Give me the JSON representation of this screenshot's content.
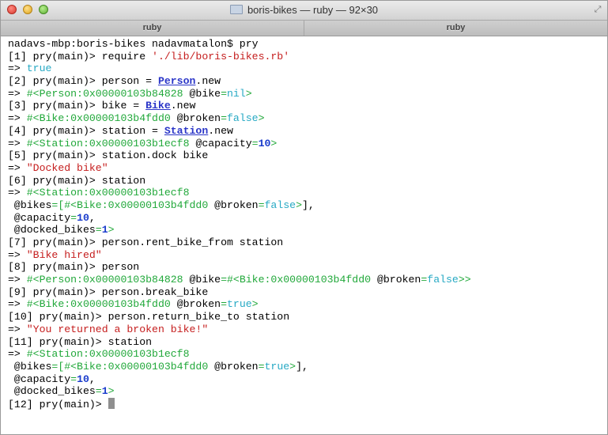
{
  "window": {
    "title": "boris-bikes — ruby — 92×30",
    "tabs": [
      "ruby",
      "ruby"
    ]
  },
  "terminal": {
    "lines": [
      {
        "segments": [
          {
            "text": "nadavs-mbp:boris-bikes nadavmatalon$ pry",
            "style": "plain"
          }
        ]
      },
      {
        "segments": [
          {
            "text": "[1] pry(main)> require ",
            "style": "plain"
          },
          {
            "text": "'./lib/boris-bikes.rb'",
            "style": "str"
          }
        ]
      },
      {
        "segments": [
          {
            "text": "=> ",
            "style": "plain"
          },
          {
            "text": "true",
            "style": "kw"
          }
        ]
      },
      {
        "segments": [
          {
            "text": "[2] pry(main)> person = ",
            "style": "plain"
          },
          {
            "text": "Person",
            "style": "cls"
          },
          {
            "text": ".new",
            "style": "plain"
          }
        ]
      },
      {
        "segments": [
          {
            "text": "=> ",
            "style": "plain"
          },
          {
            "text": "#<Person:0x00000103b84828 ",
            "style": "rv"
          },
          {
            "text": "@bike",
            "style": "plain"
          },
          {
            "text": "=",
            "style": "rv"
          },
          {
            "text": "nil",
            "style": "kw"
          },
          {
            "text": ">",
            "style": "rv"
          }
        ]
      },
      {
        "segments": [
          {
            "text": "[3] pry(main)> bike = ",
            "style": "plain"
          },
          {
            "text": "Bike",
            "style": "cls"
          },
          {
            "text": ".new",
            "style": "plain"
          }
        ]
      },
      {
        "segments": [
          {
            "text": "=> ",
            "style": "plain"
          },
          {
            "text": "#<Bike:0x00000103b4fdd0 ",
            "style": "rv"
          },
          {
            "text": "@broken",
            "style": "plain"
          },
          {
            "text": "=",
            "style": "rv"
          },
          {
            "text": "false",
            "style": "kw"
          },
          {
            "text": ">",
            "style": "rv"
          }
        ]
      },
      {
        "segments": [
          {
            "text": "[4] pry(main)> station = ",
            "style": "plain"
          },
          {
            "text": "Station",
            "style": "cls"
          },
          {
            "text": ".new",
            "style": "plain"
          }
        ]
      },
      {
        "segments": [
          {
            "text": "=> ",
            "style": "plain"
          },
          {
            "text": "#<Station:0x00000103b1ecf8 ",
            "style": "rv"
          },
          {
            "text": "@capacity",
            "style": "plain"
          },
          {
            "text": "=",
            "style": "rv"
          },
          {
            "text": "10",
            "style": "num"
          },
          {
            "text": ">",
            "style": "rv"
          }
        ]
      },
      {
        "segments": [
          {
            "text": "[5] pry(main)> station.dock bike",
            "style": "plain"
          }
        ]
      },
      {
        "segments": [
          {
            "text": "=> ",
            "style": "plain"
          },
          {
            "text": "\"Docked bike\"",
            "style": "str"
          }
        ]
      },
      {
        "segments": [
          {
            "text": "[6] pry(main)> station",
            "style": "plain"
          }
        ]
      },
      {
        "segments": [
          {
            "text": "=> ",
            "style": "plain"
          },
          {
            "text": "#<Station:0x00000103b1ecf8",
            "style": "rv"
          }
        ]
      },
      {
        "segments": [
          {
            "text": " @bikes",
            "style": "plain"
          },
          {
            "text": "=[",
            "style": "rv"
          },
          {
            "text": "#<Bike:0x00000103b4fdd0 ",
            "style": "rv"
          },
          {
            "text": "@broken",
            "style": "plain"
          },
          {
            "text": "=",
            "style": "rv"
          },
          {
            "text": "false",
            "style": "kw"
          },
          {
            "text": ">",
            "style": "rv"
          },
          {
            "text": "],",
            "style": "plain"
          }
        ]
      },
      {
        "segments": [
          {
            "text": " @capacity",
            "style": "plain"
          },
          {
            "text": "=",
            "style": "rv"
          },
          {
            "text": "10",
            "style": "num"
          },
          {
            "text": ",",
            "style": "plain"
          }
        ]
      },
      {
        "segments": [
          {
            "text": " @docked_bikes",
            "style": "plain"
          },
          {
            "text": "=",
            "style": "rv"
          },
          {
            "text": "1",
            "style": "num"
          },
          {
            "text": ">",
            "style": "rv"
          }
        ]
      },
      {
        "segments": [
          {
            "text": "[7] pry(main)> person.rent_bike_from station",
            "style": "plain"
          }
        ]
      },
      {
        "segments": [
          {
            "text": "=> ",
            "style": "plain"
          },
          {
            "text": "\"Bike hired\"",
            "style": "str"
          }
        ]
      },
      {
        "segments": [
          {
            "text": "[8] pry(main)> person",
            "style": "plain"
          }
        ]
      },
      {
        "segments": [
          {
            "text": "=> ",
            "style": "plain"
          },
          {
            "text": "#<Person:0x00000103b84828 ",
            "style": "rv"
          },
          {
            "text": "@bike",
            "style": "plain"
          },
          {
            "text": "=",
            "style": "rv"
          },
          {
            "text": "#<Bike:0x00000103b4fdd0 ",
            "style": "rv"
          },
          {
            "text": "@broken",
            "style": "plain"
          },
          {
            "text": "=",
            "style": "rv"
          },
          {
            "text": "false",
            "style": "kw"
          },
          {
            "text": ">>",
            "style": "rv"
          }
        ]
      },
      {
        "segments": [
          {
            "text": "[9] pry(main)> person.break_bike",
            "style": "plain"
          }
        ]
      },
      {
        "segments": [
          {
            "text": "=> ",
            "style": "plain"
          },
          {
            "text": "#<Bike:0x00000103b4fdd0 ",
            "style": "rv"
          },
          {
            "text": "@broken",
            "style": "plain"
          },
          {
            "text": "=",
            "style": "rv"
          },
          {
            "text": "true",
            "style": "kw"
          },
          {
            "text": ">",
            "style": "rv"
          }
        ]
      },
      {
        "segments": [
          {
            "text": "[10] pry(main)> person.return_bike_to station",
            "style": "plain"
          }
        ]
      },
      {
        "segments": [
          {
            "text": "=> ",
            "style": "plain"
          },
          {
            "text": "\"You returned a broken bike!\"",
            "style": "str"
          }
        ]
      },
      {
        "segments": [
          {
            "text": "[11] pry(main)> station",
            "style": "plain"
          }
        ]
      },
      {
        "segments": [
          {
            "text": "=> ",
            "style": "plain"
          },
          {
            "text": "#<Station:0x00000103b1ecf8",
            "style": "rv"
          }
        ]
      },
      {
        "segments": [
          {
            "text": " @bikes",
            "style": "plain"
          },
          {
            "text": "=[",
            "style": "rv"
          },
          {
            "text": "#<Bike:0x00000103b4fdd0 ",
            "style": "rv"
          },
          {
            "text": "@broken",
            "style": "plain"
          },
          {
            "text": "=",
            "style": "rv"
          },
          {
            "text": "true",
            "style": "kw"
          },
          {
            "text": ">",
            "style": "rv"
          },
          {
            "text": "],",
            "style": "plain"
          }
        ]
      },
      {
        "segments": [
          {
            "text": " @capacity",
            "style": "plain"
          },
          {
            "text": "=",
            "style": "rv"
          },
          {
            "text": "10",
            "style": "num"
          },
          {
            "text": ",",
            "style": "plain"
          }
        ]
      },
      {
        "segments": [
          {
            "text": " @docked_bikes",
            "style": "plain"
          },
          {
            "text": "=",
            "style": "rv"
          },
          {
            "text": "1",
            "style": "num"
          },
          {
            "text": ">",
            "style": "rv"
          }
        ]
      },
      {
        "segments": [
          {
            "text": "[12] pry(main)> ",
            "style": "plain"
          }
        ]
      }
    ]
  }
}
